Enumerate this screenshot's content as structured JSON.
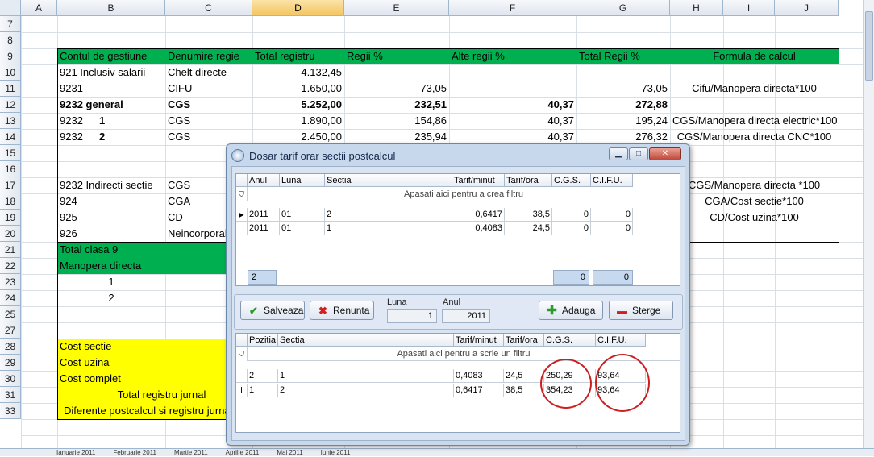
{
  "columns": [
    "A",
    "B",
    "C",
    "D",
    "E",
    "F",
    "G",
    "H",
    "I",
    "J"
  ],
  "selected_column": "D",
  "rows": [
    "7",
    "8",
    "9",
    "10",
    "11",
    "12",
    "13",
    "14",
    "15",
    "16",
    "17",
    "18",
    "19",
    "20",
    "21",
    "22",
    "23",
    "24",
    "25",
    "27",
    "28",
    "29",
    "30",
    "31",
    "33"
  ],
  "headers": {
    "b": "Contul de gestiune",
    "c": "Denumire regie",
    "d": "Total registru",
    "e": "Regii %",
    "f": "Alte regii %",
    "g": "Total Regii %",
    "h": "Formula de calcul"
  },
  "table": [
    {
      "b": "921 Inclusiv salarii",
      "c": "Chelt directe",
      "d": "4.132,45",
      "e": "",
      "f": "",
      "g": "",
      "h": ""
    },
    {
      "b": "9231",
      "c": "CIFU",
      "d": "1.650,00",
      "e": "73,05",
      "f": "",
      "g": "73,05",
      "h": "Cifu/Manopera directa*100"
    },
    {
      "b": "9232 general",
      "c": "CGS",
      "d": "5.252,00",
      "e": "232,51",
      "f": "40,37",
      "g": "272,88",
      "h": ""
    },
    {
      "b": "9232",
      "b2": "1",
      "c": "CGS",
      "d": "1.890,00",
      "e": "154,86",
      "f": "40,37",
      "g": "195,24",
      "h": "CGS/Manopera directa electric*100"
    },
    {
      "b": "9232",
      "b2": "2",
      "c": "CGS",
      "d": "2.450,00",
      "e": "235,94",
      "f": "40,37",
      "g": "276,32",
      "h": "CGS/Manopera directa CNC*100"
    }
  ],
  "lower": [
    {
      "b": "9232 Indirecti sectie",
      "c": "CGS",
      "h": "CGS/Manopera directa *100"
    },
    {
      "b": "924",
      "c": "CGA",
      "h": "CGA/Cost sectie*100"
    },
    {
      "b": "925",
      "c": "CD",
      "h": "CD/Cost uzina*100"
    },
    {
      "b": "926",
      "c": "Neincorporabile",
      "h": ""
    }
  ],
  "green_rows": [
    "Total clasa 9",
    "Manopera directa"
  ],
  "numbered": [
    "1",
    "2"
  ],
  "yellow_rows": [
    "Cost sectie",
    "Cost uzina",
    "Cost complet",
    "Total registru jurnal",
    "Diferente postcalcul si registru jurnal"
  ],
  "sheet_tabs": [
    "Ianuarie 2011",
    "Februarie 2011",
    "Martie 2011",
    "Aprilie 2011",
    "Mai 2011",
    "Iunie 2011"
  ],
  "dialog": {
    "title": "Dosar tarif orar sectii postcalcul",
    "top_grid": {
      "headers": [
        "Anul",
        "Luna",
        "Sectia",
        "Tarif/minut",
        "Tarif/ora",
        "C.G.S.",
        "C.I.F.U."
      ],
      "filter_text": "Apasati aici pentru a  crea filtru",
      "rows": [
        [
          "2011",
          "01",
          "2",
          "0,6417",
          "38,5",
          "0",
          "0"
        ],
        [
          "2011",
          "01",
          "1",
          "0,4083",
          "24,5",
          "0",
          "0"
        ]
      ],
      "footer_count": "2",
      "footer_cgs": "0",
      "footer_cifu": "0"
    },
    "save_label": "Salveaza",
    "cancel_label": "Renunta",
    "luna_label": "Luna",
    "luna_value": "1",
    "anul_label": "Anul",
    "anul_value": "2011",
    "add_label": "Adauga",
    "delete_label": "Sterge",
    "bottom_grid": {
      "headers": [
        "Pozitia",
        "Sectia",
        "Tarif/minut",
        "Tarif/ora",
        "C.G.S.",
        "C.I.F.U."
      ],
      "filter_text": "Apasati aici pentru a scrie un filtru",
      "rows": [
        [
          "2",
          "1",
          "0,4083",
          "24,5",
          "250,29",
          "93,64"
        ],
        [
          "1",
          "2",
          "0,6417",
          "38,5",
          "354,23",
          "93,64"
        ]
      ]
    }
  },
  "colors": {
    "green": "#00b050",
    "yellow": "#ffff00",
    "highlight_ellipse": "#cc2020"
  }
}
